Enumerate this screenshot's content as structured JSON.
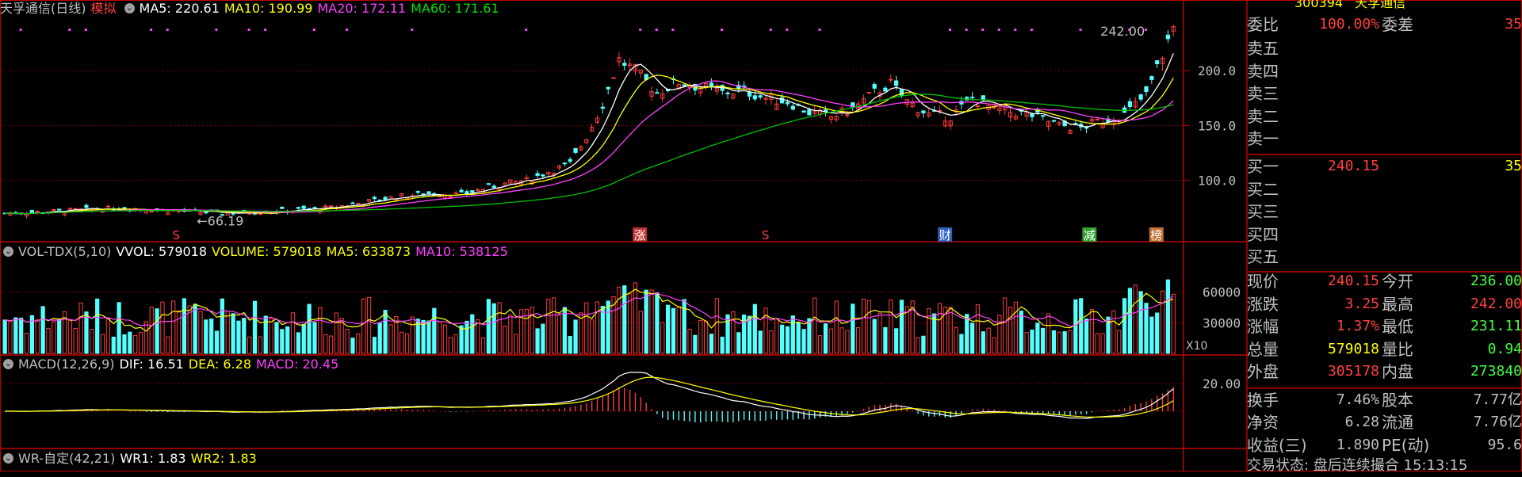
{
  "colors": {
    "up": "#ff3c3c",
    "down": "#54ffff",
    "ma5": "#ffffff",
    "ma10": "#ffff00",
    "ma20": "#ff40ff",
    "ma60": "#00c000",
    "grid": "#880000",
    "axis": "#c0c0c0",
    "frame": "#c00000"
  },
  "main_header": {
    "stock": "天孚通信(日线)",
    "mode": "模拟",
    "ma5": "MA5: 220.61",
    "ma10": "MA10: 190.99",
    "ma20": "MA20: 172.11",
    "ma60": "MA60: 171.61"
  },
  "vol_header": {
    "name": "VOL-TDX(5,10)",
    "vvol": "VVOL: 579018",
    "volume": "VOLUME: 579018",
    "ma5": "MA5: 633873",
    "ma10": "MA10: 538125"
  },
  "macd_header": {
    "name": "MACD(12,26,9)",
    "dif": "DIF: 16.51",
    "dea": "DEA: 6.28",
    "macd": "MACD: 20.45"
  },
  "wr_header": {
    "name": "WR-自定(42,21)",
    "wr1": "WR1: 1.83",
    "wr2": "WR2: 1.83"
  },
  "price_axis": {
    "ticks": [
      "200.0",
      "150.0",
      "100.0"
    ]
  },
  "vol_axis": {
    "ticks": [
      "60000",
      "30000"
    ],
    "unit": "X10"
  },
  "macd_axis": {
    "ticks": [
      "20.00"
    ]
  },
  "annotations": {
    "high": "242.00",
    "low": "66.19"
  },
  "markers": [
    {
      "label": "S",
      "x": 0.15
    },
    {
      "label": "涨",
      "x": 0.545
    },
    {
      "label": "S",
      "x": 0.652
    },
    {
      "label": "财",
      "x": 0.805
    },
    {
      "label": "减",
      "x": 0.928
    },
    {
      "label": "榜",
      "x": 0.985
    }
  ],
  "sidebar": {
    "code_partial": "300394",
    "name_partial": "天孚通信",
    "webi": {
      "l": "委比",
      "v": "100.00%",
      "l2": "委差",
      "v2": "35"
    },
    "asks": [
      "卖五",
      "卖四",
      "卖三",
      "卖二",
      "卖一"
    ],
    "bids": [
      {
        "l": "买一",
        "v": "240.15",
        "v2": "35"
      },
      {
        "l": "买二",
        "v": "",
        "v2": ""
      },
      {
        "l": "买三",
        "v": "",
        "v2": ""
      },
      {
        "l": "买四",
        "v": "",
        "v2": ""
      },
      {
        "l": "买五",
        "v": "",
        "v2": ""
      }
    ],
    "stats": [
      {
        "l": "现价",
        "v": "240.15",
        "l2": "今开",
        "v2": "236.00",
        "c1": "#ff4040",
        "c2": "#40ff40"
      },
      {
        "l": "涨跌",
        "v": "3.25",
        "l2": "最高",
        "v2": "242.00",
        "c1": "#ff4040",
        "c2": "#ff4040"
      },
      {
        "l": "涨幅",
        "v": "1.37%",
        "l2": "最低",
        "v2": "231.11",
        "c1": "#ff4040",
        "c2": "#40ff40"
      },
      {
        "l": "总量",
        "v": "579018",
        "l2": "量比",
        "v2": "0.94",
        "c1": "#ffff00",
        "c2": "#40ff40"
      },
      {
        "l": "外盘",
        "v": "305178",
        "l2": "内盘",
        "v2": "273840",
        "c1": "#ff4040",
        "c2": "#40ff40"
      },
      {
        "l": "换手",
        "v": "7.46%",
        "l2": "股本",
        "v2": "7.77亿",
        "c1": "#c0c0c0",
        "c2": "#c0c0c0"
      },
      {
        "l": "净资",
        "v": "6.28",
        "l2": "流通",
        "v2": "7.76亿",
        "c1": "#c0c0c0",
        "c2": "#c0c0c0"
      },
      {
        "l": "收益(三)",
        "v": "1.890",
        "l2": "PE(动)",
        "v2": "95.6",
        "c1": "#c0c0c0",
        "c2": "#c0c0c0"
      }
    ],
    "status": "交易状态: 盘后连续撮合 15:13:15"
  },
  "chart_data": {
    "type": "candlestick",
    "price_range": [
      60,
      250
    ],
    "volume_range": [
      0,
      90000
    ],
    "macd_range": [
      -12,
      28
    ],
    "anchors": [
      [
        0,
        70
      ],
      [
        10,
        72
      ],
      [
        22,
        75
      ],
      [
        32,
        72
      ],
      [
        40,
        70
      ],
      [
        50,
        72
      ],
      [
        60,
        75
      ],
      [
        66,
        80
      ],
      [
        72,
        85
      ],
      [
        78,
        88
      ],
      [
        84,
        87
      ],
      [
        90,
        95
      ],
      [
        96,
        100
      ],
      [
        100,
        108
      ],
      [
        104,
        115
      ],
      [
        107,
        140
      ],
      [
        110,
        170
      ],
      [
        113,
        210
      ],
      [
        116,
        200
      ],
      [
        120,
        180
      ],
      [
        124,
        190
      ],
      [
        128,
        185
      ],
      [
        132,
        180
      ],
      [
        136,
        182
      ],
      [
        140,
        175
      ],
      [
        144,
        172
      ],
      [
        148,
        162
      ],
      [
        152,
        158
      ],
      [
        156,
        165
      ],
      [
        160,
        180
      ],
      [
        163,
        188
      ],
      [
        166,
        172
      ],
      [
        170,
        160
      ],
      [
        174,
        158
      ],
      [
        178,
        175
      ],
      [
        182,
        165
      ],
      [
        186,
        162
      ],
      [
        190,
        158
      ],
      [
        194,
        150
      ],
      [
        198,
        148
      ],
      [
        202,
        155
      ],
      [
        206,
        160
      ],
      [
        210,
        178
      ],
      [
        213,
        215
      ],
      [
        215,
        240
      ]
    ]
  }
}
